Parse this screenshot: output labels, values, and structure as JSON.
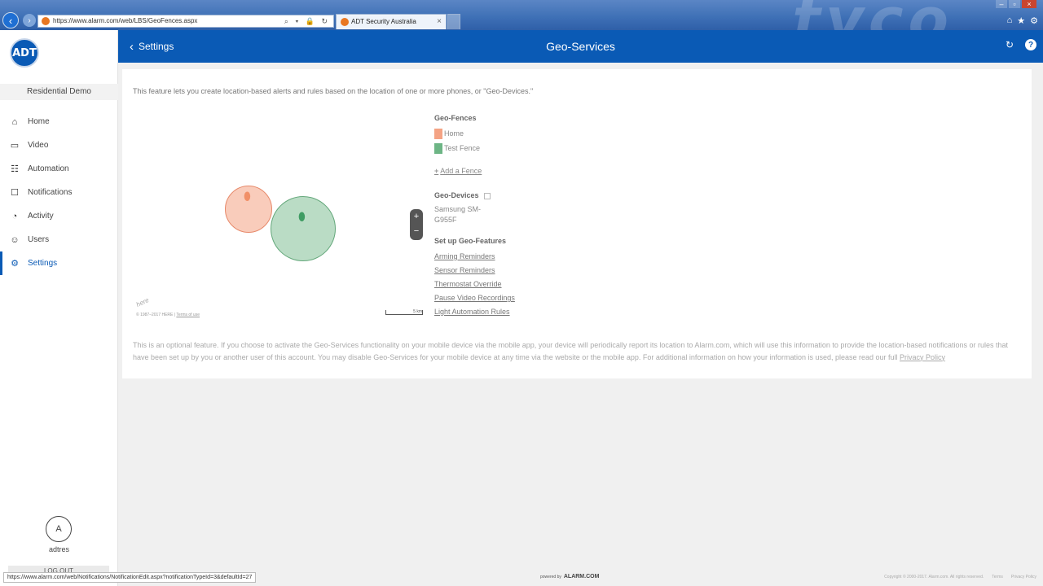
{
  "browser": {
    "url": "https://www.alarm.com/web/LBS/GeoFences.aspx",
    "tab_title": "ADT Security Australia",
    "tab_close": "×",
    "back_icon": "‹",
    "forward_icon": "›",
    "address_controls": "⌕ ▾ 🔒 ↻"
  },
  "sidebar": {
    "logo": "ADT",
    "account_name": "Residential Demo",
    "items": [
      {
        "label": "Home",
        "icon": "home-icon"
      },
      {
        "label": "Video",
        "icon": "video-icon"
      },
      {
        "label": "Automation",
        "icon": "sliders-icon"
      },
      {
        "label": "Notifications",
        "icon": "notification-icon"
      },
      {
        "label": "Activity",
        "icon": "activity-icon"
      },
      {
        "label": "Users",
        "icon": "users-icon"
      },
      {
        "label": "Settings",
        "icon": "gear-icon",
        "active": true
      }
    ],
    "avatar_letter": "A",
    "username": "adtres",
    "logout": "LOG OUT"
  },
  "header": {
    "back_label": "Settings",
    "title": "Geo-Services"
  },
  "main": {
    "intro": "This feature lets you create location-based alerts and rules based on the location of one or more phones, or \"Geo-Devices.\"",
    "map": {
      "zoom_in": "+",
      "zoom_out": "−",
      "here_logo": "here",
      "copyright": "© 1987–2017 HERE | ",
      "terms": "Terms of use",
      "scale": "5 km"
    },
    "geo_fences_title": "Geo-Fences",
    "fences": [
      {
        "label": "Home",
        "color": "#f4a384"
      },
      {
        "label": "Test Fence",
        "color": "#6db585"
      }
    ],
    "add_fence": "Add a Fence",
    "geo_devices_title": "Geo-Devices",
    "device": "Samsung SM-G955F",
    "features_title": "Set up Geo-Features",
    "features": [
      "Arming Reminders",
      "Sensor Reminders",
      "Thermostat Override",
      "Pause Video Recordings",
      "Light Automation Rules"
    ],
    "disclaimer": "This is an optional feature. If you choose to activate the Geo-Services functionality on your mobile device via the mobile app, your device will periodically report its location to Alarm.com, which will use this information to provide the location-based notifications or rules that have been set up by you or another user of this account. You may disable Geo-Services for your mobile device at any time via the website or the mobile app. For additional information on how your information is used, please read our full ",
    "privacy_link": "Privacy Policy"
  },
  "footer": {
    "status_url": "https://www.alarm.com/web/Notifications/NotificationEdit.aspx?notificationTypeId=3&defaultId=27",
    "powered_by": "powered by",
    "brand": "ALARM.COM",
    "copyright": "Copyright © 2000-2017. Alarm.com. All rights reserved.",
    "terms": "Terms",
    "privacy": "Privacy Policy"
  },
  "colors": {
    "brand_blue": "#0a5ab5",
    "home_fence": "#f4a384",
    "test_fence": "#6db585"
  }
}
